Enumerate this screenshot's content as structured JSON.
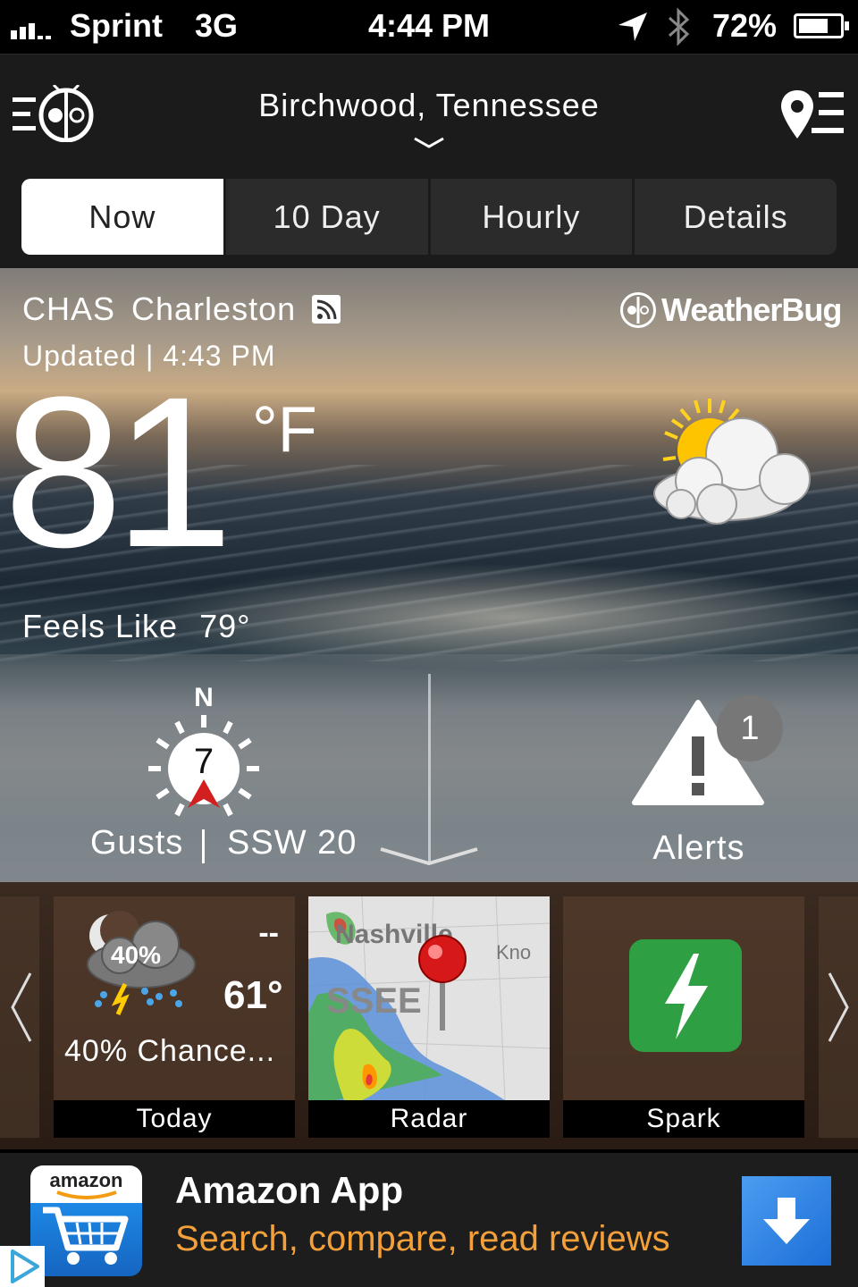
{
  "status_bar": {
    "carrier": "Sprint",
    "network": "3G",
    "time": "4:44 PM",
    "battery": "72%",
    "battery_level": 0.72,
    "icons": [
      "signal-icon",
      "location-arrow-icon",
      "bluetooth-icon",
      "battery-icon"
    ]
  },
  "header": {
    "location": "Birchwood, Tennessee",
    "icons": [
      "menu-bug-icon",
      "chevron-down-icon",
      "location-list-icon"
    ]
  },
  "tabs": [
    {
      "label": "Now",
      "active": true
    },
    {
      "label": "10 Day",
      "active": false
    },
    {
      "label": "Hourly",
      "active": false
    },
    {
      "label": "Details",
      "active": false
    }
  ],
  "current": {
    "station_code": "CHAS",
    "station_name": "Charleston",
    "updated_label": "Updated",
    "updated_sep": "|",
    "updated_time": "4:43 PM",
    "brand": "WeatherBug",
    "temperature": "81",
    "unit": "°F",
    "feels_label": "Feels Like",
    "feels_value": "79°",
    "condition_icon": "partly-cloudy-icon"
  },
  "wind": {
    "north_label": "N",
    "speed": "7",
    "gusts_label": "Gusts",
    "gusts_value": "SSW 20"
  },
  "alerts": {
    "count": "1",
    "label": "Alerts"
  },
  "cards": [
    {
      "label": "Today",
      "precip_badge": "40%",
      "high": "--",
      "low": "61°",
      "description": "40% Chance..."
    },
    {
      "label": "Radar",
      "map_text": [
        "Nashville",
        "Kno",
        "SSEE"
      ]
    },
    {
      "label": "Spark"
    }
  ],
  "ad": {
    "logo_word": "amazon",
    "title": "Amazon App",
    "subtitle": "Search, compare, read reviews"
  },
  "colors": {
    "header_bg": "#1b1b1b",
    "tab_active_bg": "#ffffff",
    "alert_badge": "#777777",
    "spark_green": "#2ea043",
    "ad_subtitle": "#f3a03a",
    "wind_pointer": "#d21f1f"
  }
}
